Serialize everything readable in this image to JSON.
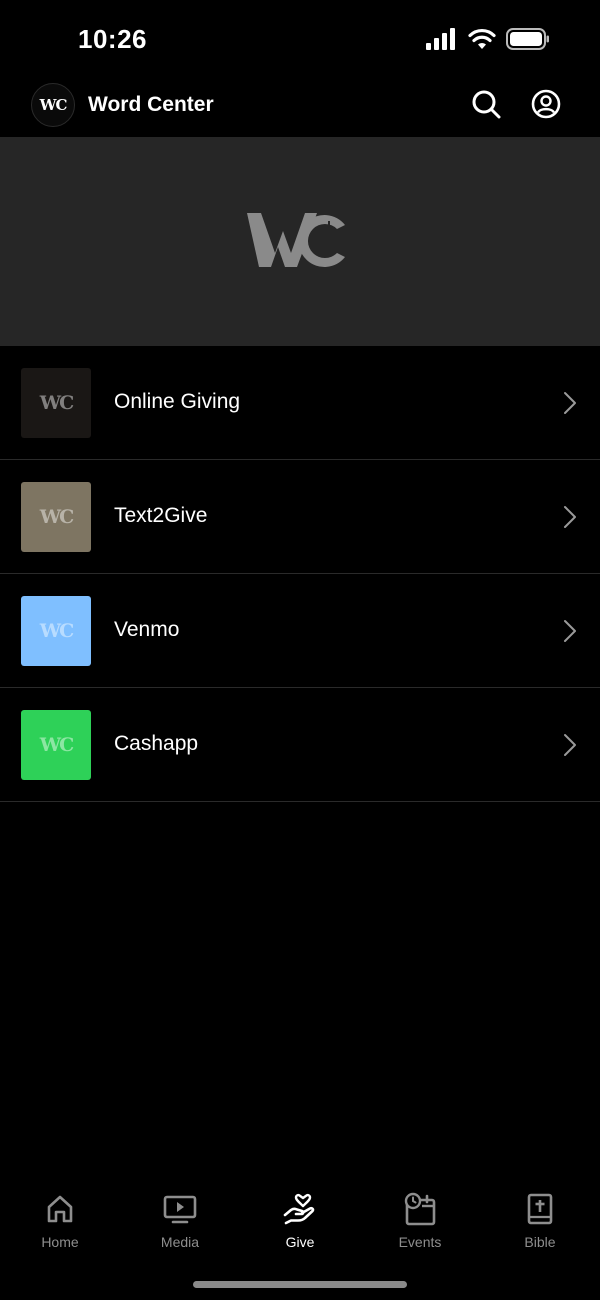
{
  "status_bar": {
    "time": "10:26"
  },
  "header": {
    "logo_text": "WC",
    "title": "Word Center"
  },
  "banner": {
    "logo_text": "WC"
  },
  "give_options": [
    {
      "label": "Online Giving",
      "thumb_color": "#1a1715",
      "thumb_text": "WC"
    },
    {
      "label": "Text2Give",
      "thumb_color": "#7e7562",
      "thumb_text": "WC"
    },
    {
      "label": "Venmo",
      "thumb_color": "#7fbfff",
      "thumb_text": "WC"
    },
    {
      "label": "Cashapp",
      "thumb_color": "#2ed158",
      "thumb_text": "WC"
    }
  ],
  "tabs": [
    {
      "label": "Home",
      "icon": "house-icon",
      "active": false
    },
    {
      "label": "Media",
      "icon": "play-screen-icon",
      "active": false
    },
    {
      "label": "Give",
      "icon": "hand-heart-icon",
      "active": true
    },
    {
      "label": "Events",
      "icon": "calendar-clock-icon",
      "active": false
    },
    {
      "label": "Bible",
      "icon": "bible-icon",
      "active": false
    }
  ],
  "colors": {
    "background": "#000000",
    "banner": "#262626",
    "divider": "#2a2a2a",
    "tab_inactive": "#8e8e8e",
    "tab_active": "#ffffff"
  }
}
